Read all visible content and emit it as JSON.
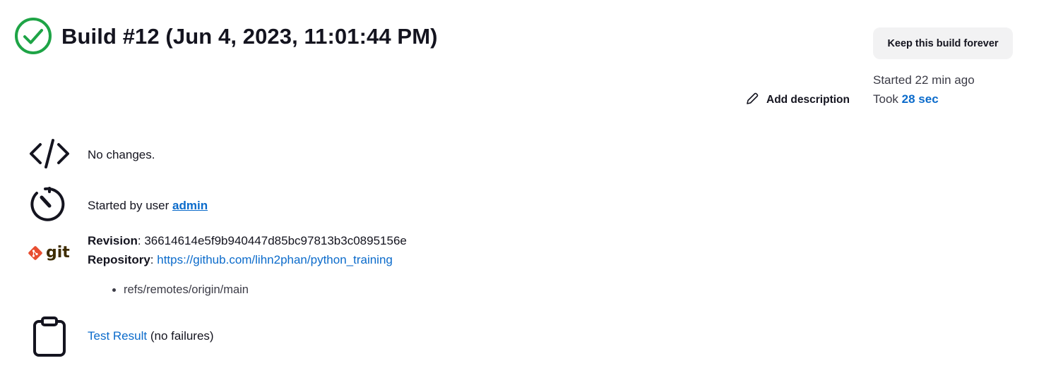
{
  "header": {
    "title": "Build #12 (Jun 4, 2023, 11:01:44 PM)",
    "status_color": "#1ea446",
    "keep_button_label": "Keep this build forever"
  },
  "description": {
    "add_label": "Add description"
  },
  "meta": {
    "started_text": "Started 22 min ago",
    "took_prefix": "Took",
    "took_value": "28 sec"
  },
  "changes": {
    "text": "No changes."
  },
  "cause": {
    "prefix": "Started by user",
    "user": "admin"
  },
  "git": {
    "revision_label": "Revision",
    "revision_value": "36614614e5f9b940447d85bc97813b3c0895156e",
    "repository_label": "Repository",
    "repository_url": "https://github.com/lihn2phan/python_training",
    "branches": [
      "refs/remotes/origin/main"
    ],
    "logo_text": "git"
  },
  "tests": {
    "link_label": "Test Result",
    "suffix": "(no failures)"
  },
  "colors": {
    "accent": "#0b6bcb",
    "success": "#1ea446",
    "button_bg": "#f2f2f3"
  }
}
